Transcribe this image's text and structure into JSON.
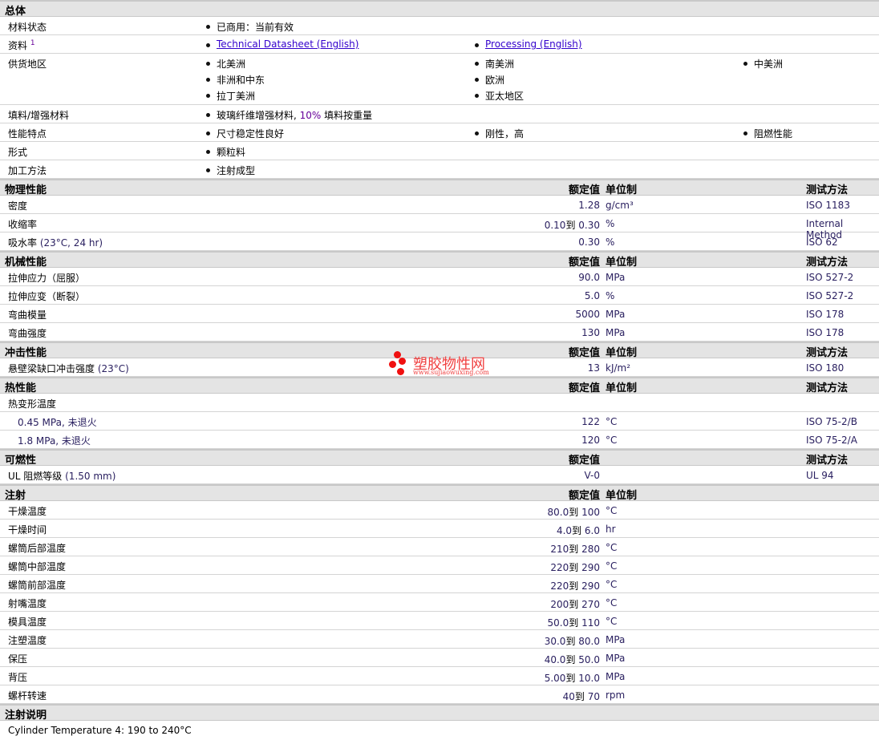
{
  "general": {
    "title": "总体",
    "status_label": "材料状态",
    "status_value": "已商用：当前有效",
    "docs_label": "资料",
    "docs_sup": "1",
    "docs": [
      "Technical Datasheet (English)",
      "Processing (English)"
    ],
    "supply_label": "供货地区",
    "supply": [
      "北美洲",
      "南美洲",
      "中美洲",
      "非洲和中东",
      "欧洲",
      "拉丁美洲",
      "亚太地区"
    ],
    "filler_label": "填料/增强材料",
    "filler_pre": "玻璃纤维增强材料,",
    "filler_pct": "10%",
    "filler_post": "填料按重量",
    "features_label": "性能特点",
    "features": [
      "尺寸稳定性良好",
      "刚性，高",
      "阻燃性能"
    ],
    "form_label": "形式",
    "form_value": "颗粒料",
    "process_label": "加工方法",
    "process_value": "注射成型"
  },
  "headers": {
    "value": "额定值",
    "unit": "单位制",
    "method": "测试方法"
  },
  "sections": [
    {
      "title": "物理性能",
      "cols": [
        "v",
        "u",
        "m"
      ],
      "rows": [
        {
          "label": "密度",
          "value": "1.28",
          "unit": "g/cm³",
          "method": "ISO 1183"
        },
        {
          "label": "收缩率",
          "from": "0.10",
          "to": "到",
          "value": "0.30",
          "unit": "%",
          "method": "Internal Method"
        },
        {
          "label": "吸水率",
          "cond": "(23°C, 24 hr)",
          "value": "0.30",
          "unit": "%",
          "method": "ISO 62"
        }
      ]
    },
    {
      "title": "机械性能",
      "cols": [
        "v",
        "u",
        "m"
      ],
      "rows": [
        {
          "label": "拉伸应力（屈服）",
          "value": "90.0",
          "unit": "MPa",
          "method": "ISO 527-2"
        },
        {
          "label": "拉伸应变（断裂）",
          "value": "5.0",
          "unit": "%",
          "method": "ISO 527-2"
        },
        {
          "label": "弯曲模量",
          "value": "5000",
          "unit": "MPa",
          "method": "ISO 178"
        },
        {
          "label": "弯曲强度",
          "value": "130",
          "unit": "MPa",
          "method": "ISO 178"
        }
      ]
    },
    {
      "title": "冲击性能",
      "cols": [
        "v",
        "u",
        "m"
      ],
      "rows": [
        {
          "label": "悬壁梁缺口冲击强度",
          "cond": "(23°C)",
          "value": "13",
          "unit": "kJ/m²",
          "method": "ISO 180"
        }
      ]
    },
    {
      "title": "热性能",
      "cols": [
        "v",
        "u",
        "m"
      ],
      "rows": [
        {
          "label": "热变形温度"
        },
        {
          "label": "0.45 MPa, 未退火",
          "sub": true,
          "value": "122",
          "unit": "°C",
          "method": "ISO 75-2/B"
        },
        {
          "label": "1.8 MPa, 未退火",
          "sub": true,
          "value": "120",
          "unit": "°C",
          "method": "ISO 75-2/A"
        }
      ]
    },
    {
      "title": "可燃性",
      "cols": [
        "v",
        "m"
      ],
      "rows": [
        {
          "label": "UL 阻燃等级",
          "cond": "(1.50 mm)",
          "value": "V-0",
          "method": "UL 94"
        }
      ]
    },
    {
      "title": "注射",
      "cols": [
        "v",
        "u"
      ],
      "rows": [
        {
          "label": "干燥温度",
          "from": "80.0",
          "to": "到",
          "value": "100",
          "unit": "°C"
        },
        {
          "label": "干燥时间",
          "from": "4.0",
          "to": "到",
          "value": "6.0",
          "unit": "hr"
        },
        {
          "label": "螺筒后部温度",
          "from": "210",
          "to": "到",
          "value": "280",
          "unit": "°C"
        },
        {
          "label": "螺筒中部温度",
          "from": "220",
          "to": "到",
          "value": "290",
          "unit": "°C"
        },
        {
          "label": "螺筒前部温度",
          "from": "220",
          "to": "到",
          "value": "290",
          "unit": "°C"
        },
        {
          "label": "射嘴温度",
          "from": "200",
          "to": "到",
          "value": "270",
          "unit": "°C"
        },
        {
          "label": "模具温度",
          "from": "50.0",
          "to": "到",
          "value": "110",
          "unit": "°C"
        },
        {
          "label": "注塑温度",
          "from": "30.0",
          "to": "到",
          "value": "80.0",
          "unit": "MPa"
        },
        {
          "label": "保压",
          "from": "40.0",
          "to": "到",
          "value": "50.0",
          "unit": "MPa"
        },
        {
          "label": "背压",
          "from": "5.00",
          "to": "到",
          "value": "10.0",
          "unit": "MPa"
        },
        {
          "label": "螺杆转速",
          "from": "40",
          "to": "到",
          "value": "70",
          "unit": "rpm"
        }
      ]
    }
  ],
  "notes": {
    "title": "注射说明",
    "text": "Cylinder Temperature 4: 190 to 240°C"
  },
  "watermark": {
    "name": "塑胶物性网",
    "url": "www.sujiaowuxing.com"
  }
}
